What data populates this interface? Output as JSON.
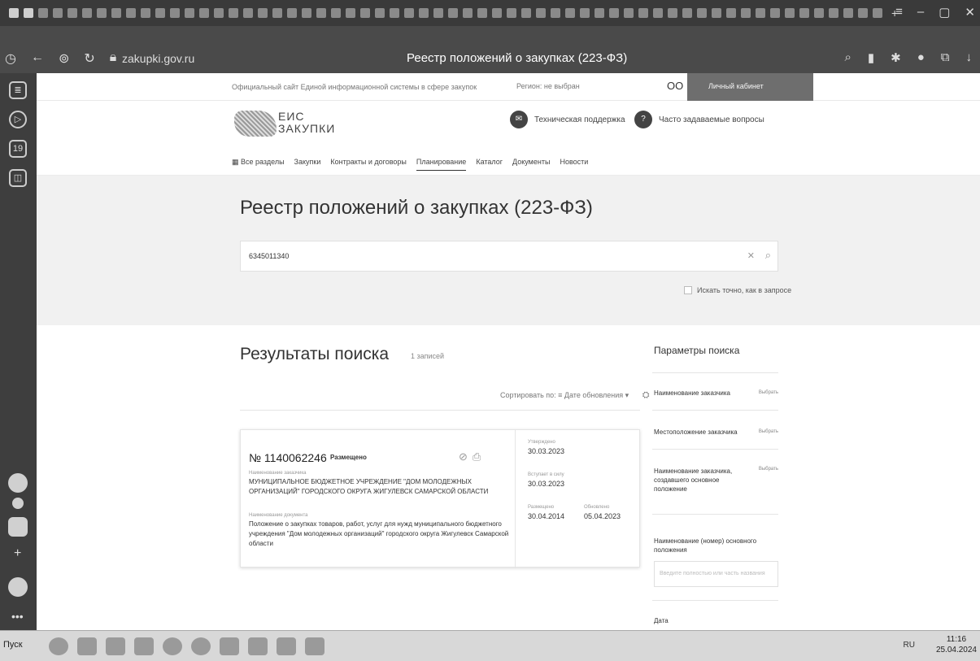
{
  "browser": {
    "url": "zakupki.gov.ru",
    "page_title": "Реестр положений о закупках (223-ФЗ)"
  },
  "topstrip": {
    "site_name": "Официальный сайт Единой информационной системы в сфере закупок",
    "region": "Регион: не выбран",
    "cabinet": "Личный кабинет"
  },
  "header": {
    "logo_line1": "ЕИС",
    "logo_line2": "ЗАКУПКИ",
    "support": "Техническая поддержка",
    "faq": "Часто задаваемые вопросы",
    "menu": [
      "Все разделы",
      "Закупки",
      "Контракты и договоры",
      "Планирование",
      "Каталог",
      "Документы",
      "Новости"
    ],
    "menu_active": "Планирование"
  },
  "page": {
    "title": "Реестр положений о закупках (223-ФЗ)",
    "search_value": "6345011340",
    "exact_label": "Искать точно, как в запросе"
  },
  "results": {
    "title": "Результаты поиска",
    "count": "1 записей",
    "sort_label": "Сортировать по: ≡ Дате обновления ▾"
  },
  "card": {
    "number": "№ 1140062246",
    "status": "Размещено",
    "customer_label": "Наименование заказчика",
    "customer": "МУНИЦИПАЛЬНОЕ БЮДЖЕТНОЕ УЧРЕЖДЕНИЕ \"ДОМ МОЛОДЕЖНЫХ ОРГАНИЗАЦИЙ\" ГОРОДСКОГО ОКРУГА ЖИГУЛЕВСК САМАРСКОЙ ОБЛАСТИ",
    "doc_label": "Наименование документа",
    "doc": "Положение о закупках товаров, работ, услуг для нужд муниципального бюджетного учреждения \"Дом молодежных организаций\" городского округа Жигулевск Самарской области",
    "approved_label": "Утверждено",
    "approved": "30.03.2023",
    "effective_label": "Вступает в силу",
    "effective": "30.03.2023",
    "placed_label": "Размещено",
    "placed": "30.04.2014",
    "updated_label": "Обновлено",
    "updated": "05.04.2023"
  },
  "params": {
    "title": "Параметры поиска",
    "pick": "Выбрать",
    "customer_name": "Наименование заказчика",
    "customer_location": "Местоположение заказчика",
    "creator": "Наименование заказчика, создавшего основное положение",
    "main_name": "Наименование (номер) основного положения",
    "main_placeholder": "Введите полностью или часть названия",
    "date": "Дата"
  },
  "taskbar": {
    "start": "Пуск",
    "lang": "RU",
    "time": "11:16",
    "date": "25.04.2024"
  }
}
